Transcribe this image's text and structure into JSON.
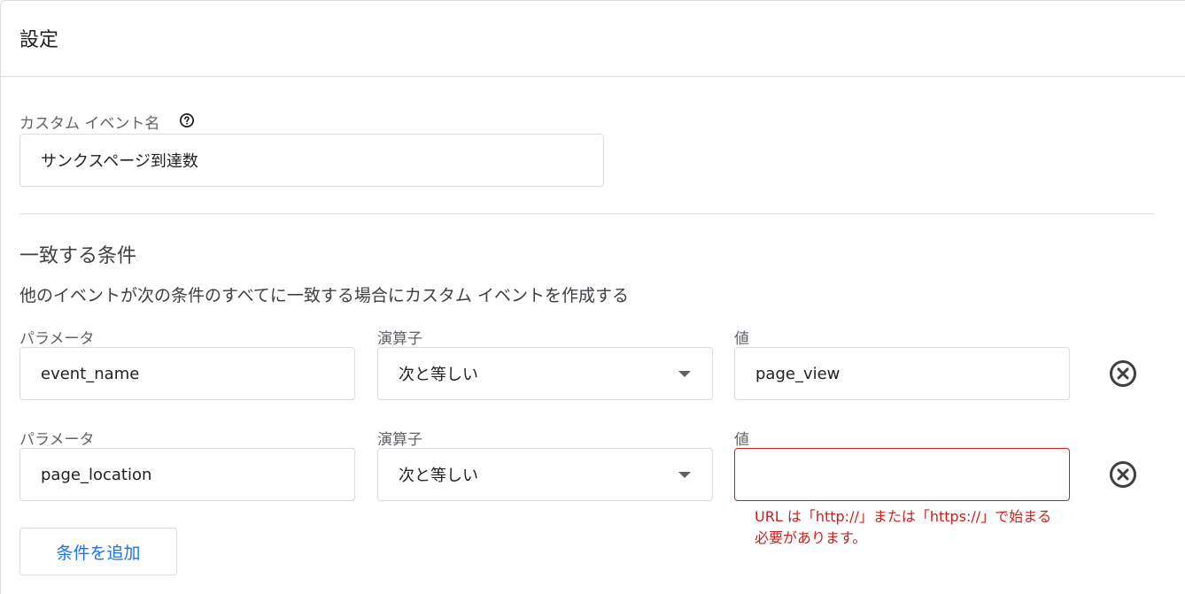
{
  "header": {
    "title": "設定"
  },
  "event_name": {
    "label": "カスタム イベント名",
    "value": "サンクスページ到達数"
  },
  "conditions": {
    "title": "一致する条件",
    "description": "他のイベントが次の条件のすべてに一致する場合にカスタム イベントを作成する",
    "rows": [
      {
        "param_label": "パラメータ",
        "param_value": "event_name",
        "operator_label": "演算子",
        "operator_value": "次と等しい",
        "value_label": "値",
        "value": "page_view"
      },
      {
        "param_label": "パラメータ",
        "param_value": "page_location",
        "operator_label": "演算子",
        "operator_value": "次と等しい",
        "value_label": "値",
        "value": "",
        "error": "URL は「http://」または「https://」で始まる必要があります。"
      }
    ],
    "add_button": "条件を追加"
  },
  "colors": {
    "error": "#c5221f",
    "accent": "#1a73e8",
    "border": "#dadce0"
  },
  "icons": [
    "help-icon",
    "dropdown-arrow-icon",
    "remove-circle-icon"
  ]
}
